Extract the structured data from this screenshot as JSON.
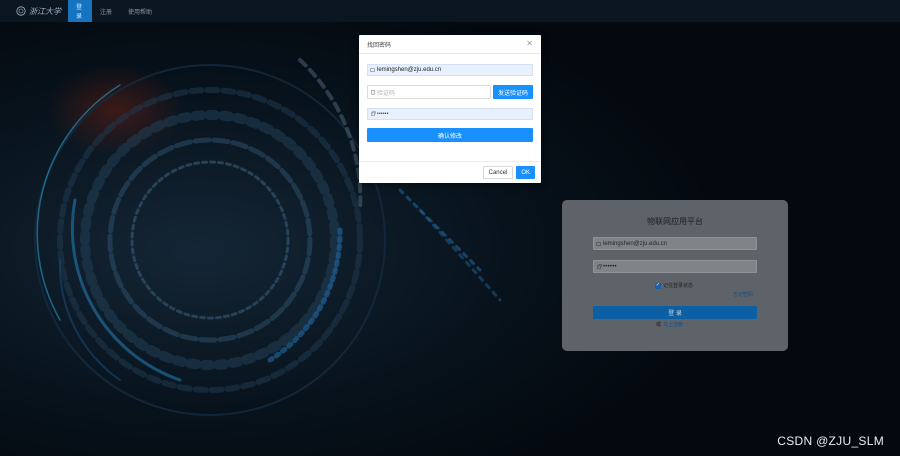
{
  "nav": {
    "logo_text": "浙江大学",
    "items": [
      {
        "label": "登录",
        "active": true
      },
      {
        "label": "注册",
        "active": false
      },
      {
        "label": "使用帮助",
        "active": false
      }
    ]
  },
  "modal": {
    "title": "找回密码",
    "email_value": "lemingshen@zju.edu.cn",
    "code_placeholder": "验证码",
    "send_code_label": "发送验证码",
    "password_value": "••••••",
    "confirm_label": "确认修改",
    "cancel_label": "Cancel",
    "ok_label": "OK"
  },
  "login": {
    "title": "物联网应用平台",
    "email_value": "lemingshen@zju.edu.cn",
    "password_value": "••••••",
    "remember_label": "记住登录状态",
    "forgot_label": "忘记密码",
    "login_label": "登 录",
    "register_prefix": "或",
    "register_link": "马上注册"
  },
  "watermark": "CSDN @ZJU_SLM",
  "colors": {
    "accent": "#1890ff",
    "background": "#07121c",
    "nav_active": "#1673c0"
  }
}
